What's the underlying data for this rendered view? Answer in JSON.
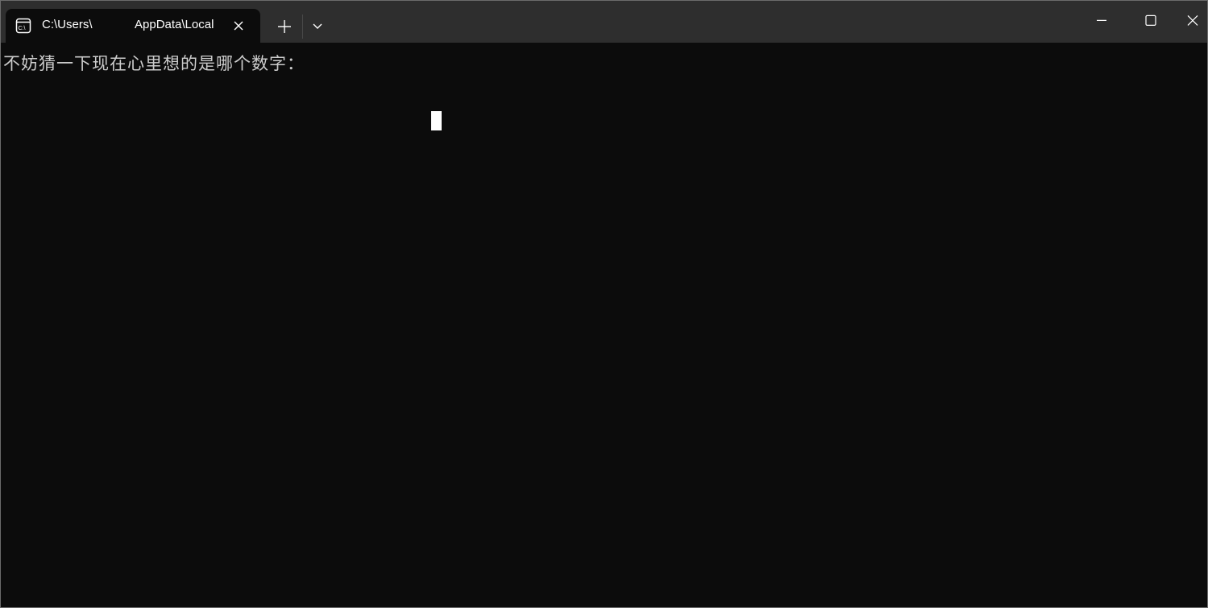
{
  "window": {
    "tab": {
      "icon": "terminal-cmd-icon",
      "title_part1": "C:\\Users\\",
      "title_part2": "AppData\\Local"
    },
    "controls": {
      "new_tab_icon": "plus-icon",
      "dropdown_icon": "chevron-down-icon",
      "minimize_icon": "minimize-icon",
      "maximize_icon": "maximize-icon",
      "close_icon": "close-icon"
    }
  },
  "terminal": {
    "output_line": "不妨猜一下现在心里想的是哪个数字："
  },
  "colors": {
    "titlebar_bg": "#2e2e2e",
    "terminal_bg": "#0c0c0c",
    "text": "#cccccc",
    "cursor": "#ffffff"
  }
}
